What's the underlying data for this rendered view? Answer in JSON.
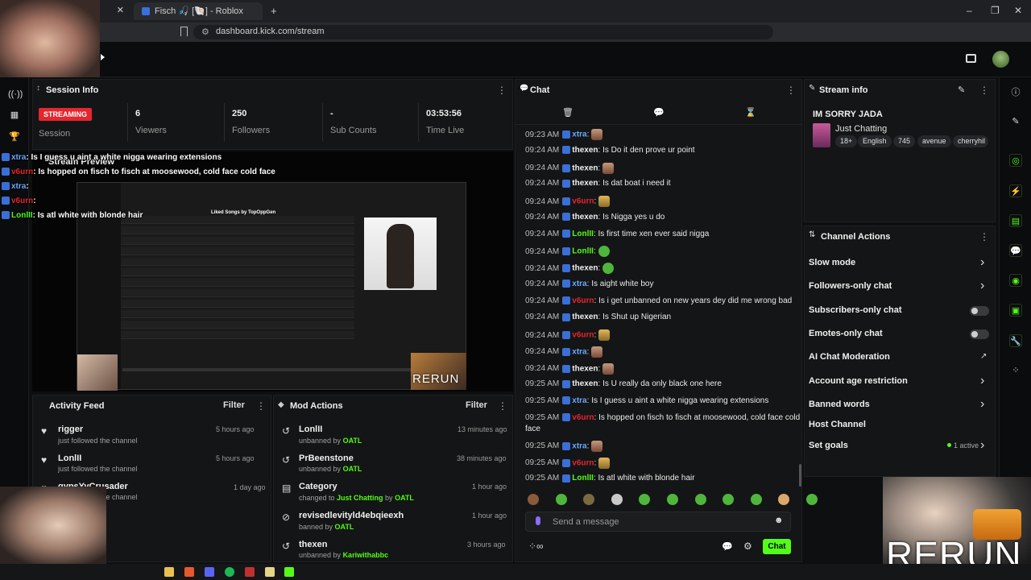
{
  "browser": {
    "tab_stream_title": "Fisch 🎣 [🐚] - Roblox",
    "url": "dashboard.kick.com/stream",
    "new_tab": "+"
  },
  "session": {
    "title": "Session Info",
    "status": "STREAMING",
    "status_label": "Session",
    "viewers": "6",
    "viewers_label": "Viewers",
    "followers": "250",
    "followers_label": "Followers",
    "subs": "-",
    "subs_label": "Sub Counts",
    "time_live": "03:53:56",
    "time_label": "Time Live"
  },
  "preview": {
    "title": "Stream Preview",
    "overlay_lines": [
      {
        "user": "xtra",
        "text": ": Is I guess u aint a white nigga wearing extensions"
      },
      {
        "user": "v6urn",
        "text": ": Is hopped on fisch to fisch at moosewood, cold face cold face"
      },
      {
        "user": "xtra",
        "text": ":"
      },
      {
        "user": "v6urn",
        "text": ":"
      },
      {
        "user": "LonlII",
        "text": ": Is atl white with blonde hair"
      }
    ],
    "song_title": "Liked Songs by TopOppGen",
    "rerun_small": "RERUN"
  },
  "activity": {
    "title": "Activity Feed",
    "filter": "Filter",
    "items": [
      {
        "name": "rigger",
        "sub": "just followed the channel",
        "time": "5 hours ago"
      },
      {
        "name": "LonlII",
        "sub": "just followed the channel",
        "time": "5 hours ago"
      },
      {
        "name": "gypsYvCrusader",
        "sub": "just followed the channel",
        "time": "1 day ago"
      }
    ]
  },
  "mod": {
    "title": "Mod Actions",
    "filter": "Filter",
    "items": [
      {
        "name": "LonlII",
        "pre": "unbanned by ",
        "by": "OATL",
        "time": "13 minutes ago"
      },
      {
        "name": "PrBeenstone",
        "pre": "unbanned by ",
        "by": "OATL",
        "time": "38 minutes ago"
      },
      {
        "name": "Category",
        "pre": "changed to ",
        "cat": "Just Chatting",
        "mid": " by ",
        "by": "OATL",
        "time": "1 hour ago"
      },
      {
        "name": "revisedlevityld4ebqieexh",
        "pre": "banned by ",
        "by": "OATL",
        "time": "1 hour ago"
      },
      {
        "name": "thexen",
        "pre": "unbanned by ",
        "by": "Kariwithabbc",
        "time": "3 hours ago"
      }
    ]
  },
  "chat": {
    "title": "Chat",
    "placeholder": "Send a message",
    "send_label": "Chat",
    "messages": [
      {
        "time": "09:23 AM",
        "user": "xtra",
        "cls": "u-xtra",
        "text": "",
        "emote": "face"
      },
      {
        "time": "09:24 AM",
        "user": "thexen",
        "cls": "u-thexen",
        "text": "Is Do it den prove ur point",
        "emote": ""
      },
      {
        "time": "09:24 AM",
        "user": "thexen",
        "cls": "u-thexen",
        "text": "",
        "emote": "face"
      },
      {
        "time": "09:24 AM",
        "user": "thexen",
        "cls": "u-thexen",
        "text": "Is dat boat i need it",
        "emote": ""
      },
      {
        "time": "09:24 AM",
        "user": "v6urn",
        "cls": "u-v6urn",
        "text": "",
        "emote": "gold"
      },
      {
        "time": "09:24 AM",
        "user": "thexen",
        "cls": "u-thexen",
        "text": "Is Nigga yes u do",
        "emote": ""
      },
      {
        "time": "09:24 AM",
        "user": "LonlII",
        "cls": "u-lonlil",
        "text": "Is first time xen ever said nigga",
        "emote": ""
      },
      {
        "time": "09:24 AM",
        "user": "LonlII",
        "cls": "u-lonlil",
        "text": "",
        "emote": "green"
      },
      {
        "time": "09:24 AM",
        "user": "thexen",
        "cls": "u-thexen",
        "text": "",
        "emote": "green"
      },
      {
        "time": "09:24 AM",
        "user": "xtra",
        "cls": "u-xtra",
        "text": "Is aight white boy",
        "emote": ""
      },
      {
        "time": "09:24 AM",
        "user": "v6urn",
        "cls": "u-v6urn",
        "text": "Is i get unbanned on new years dey did me wrong bad",
        "emote": ""
      },
      {
        "time": "09:24 AM",
        "user": "thexen",
        "cls": "u-thexen",
        "text": "Is Shut up Nigerian",
        "emote": ""
      },
      {
        "time": "09:24 AM",
        "user": "v6urn",
        "cls": "u-v6urn",
        "text": "",
        "emote": "gold"
      },
      {
        "time": "09:24 AM",
        "user": "xtra",
        "cls": "u-xtra",
        "text": "",
        "emote": "face"
      },
      {
        "time": "09:24 AM",
        "user": "thexen",
        "cls": "u-thexen",
        "text": "",
        "emote": "face"
      },
      {
        "time": "09:25 AM",
        "user": "thexen",
        "cls": "u-thexen",
        "text": "Is U really da only black one here",
        "emote": ""
      },
      {
        "time": "09:25 AM",
        "user": "xtra",
        "cls": "u-xtra",
        "text": "Is I guess u aint a white nigga wearing extensions",
        "emote": ""
      },
      {
        "time": "09:25 AM",
        "user": "v6urn",
        "cls": "u-v6urn",
        "text": "Is hopped on fisch to fisch at moosewood, cold face cold",
        "emote": "",
        "wrap": "face"
      },
      {
        "time": "09:25 AM",
        "user": "xtra",
        "cls": "u-xtra",
        "text": "",
        "emote": "face"
      },
      {
        "time": "09:25 AM",
        "user": "v6urn",
        "cls": "u-v6urn",
        "text": "",
        "emote": "gold"
      },
      {
        "time": "09:25 AM",
        "user": "LonlII",
        "cls": "u-lonlil",
        "text": "Is atl white with blonde hair",
        "emote": ""
      }
    ]
  },
  "stream_info": {
    "title": "Stream info",
    "stream_title": "IM SORRY JADA",
    "category": "Just Chatting",
    "tags": [
      "18+",
      "English",
      "745",
      "avenue",
      "cherryhil"
    ]
  },
  "actions": {
    "title": "Channel Actions",
    "rows": [
      {
        "label": "Slow mode",
        "kind": "chev"
      },
      {
        "label": "Followers-only chat",
        "kind": "chev"
      },
      {
        "label": "Subscribers-only chat",
        "kind": "toggle"
      },
      {
        "label": "Emotes-only chat",
        "kind": "toggle"
      },
      {
        "label": "AI Chat Moderation",
        "kind": "ext"
      },
      {
        "label": "Account age restriction",
        "kind": "chev"
      },
      {
        "label": "Banned words",
        "kind": "chev"
      },
      {
        "label": "Host Channel",
        "kind": "none"
      },
      {
        "label": "Set goals",
        "kind": "goal",
        "extra": "1 active"
      }
    ]
  },
  "overlay": {
    "rerun_big": "RERUN"
  },
  "colors": {
    "accent": "#53fc18",
    "live": "#e5262f",
    "mod_blue": "#6aa8ff"
  }
}
